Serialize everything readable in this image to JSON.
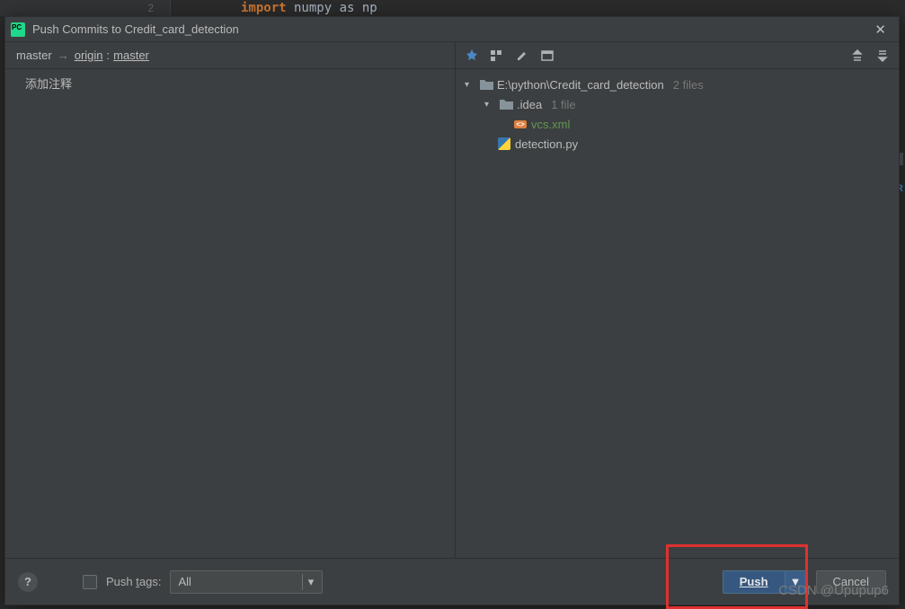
{
  "editor": {
    "line_no": "2",
    "code_keyword": "import",
    "code_rest": " numpy as np"
  },
  "dialog": {
    "title": "Push Commits to Credit_card_detection",
    "branch": {
      "local": "master",
      "remote": "origin",
      "remote_branch": "master"
    },
    "commit_placeholder": "添加注释"
  },
  "tree": {
    "root": {
      "path": "E:\\python\\Credit_card_detection",
      "count": "2 files"
    },
    "idea": {
      "name": ".idea",
      "count": "1 file"
    },
    "vcs_file": "vcs.xml",
    "py_file": "detection.py"
  },
  "footer": {
    "push_tags_label": "Push tags:",
    "push_tags_underline": "t",
    "select_value": "All",
    "push_label": "Push",
    "cancel_label": "Cancel"
  },
  "watermark": "CSDN @Upupup6",
  "right_letter": "R"
}
